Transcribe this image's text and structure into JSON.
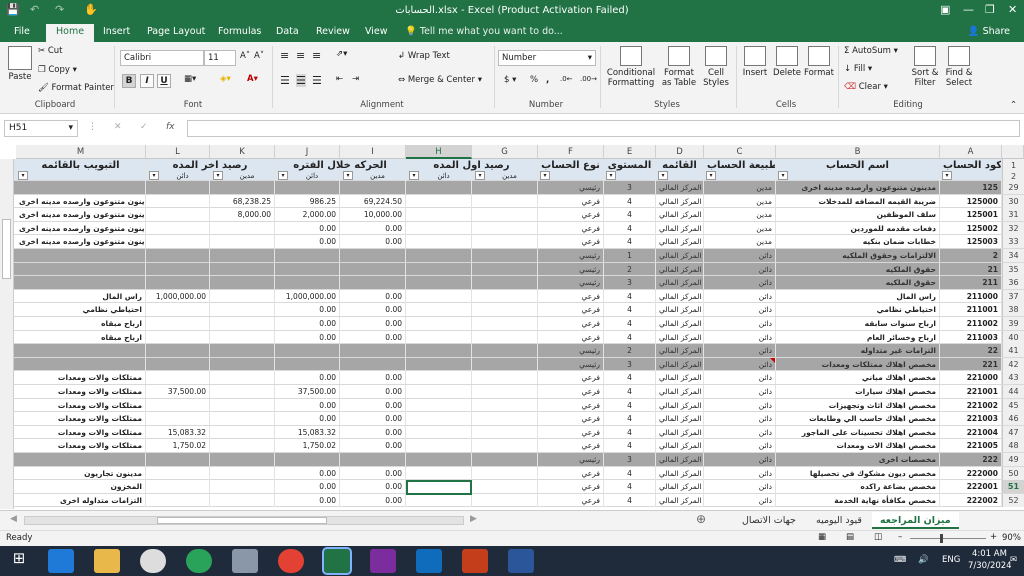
{
  "titlebar": {
    "title": "الحسابات.xlsx - Excel (Product Activation Failed)"
  },
  "menu": {
    "tabs": [
      "File",
      "Home",
      "Insert",
      "Page Layout",
      "Formulas",
      "Data",
      "Review",
      "View"
    ],
    "tell": "Tell me what you want to do...",
    "share": "Share"
  },
  "ribbon": {
    "clipboard": {
      "paste": "Paste",
      "cut": "Cut",
      "copy": "Copy",
      "format_painter": "Format Painter",
      "label": "Clipboard"
    },
    "font": {
      "name": "Calibri",
      "size": "11",
      "bold": "B",
      "italic": "I",
      "underline": "U",
      "label": "Font"
    },
    "alignment": {
      "wrap": "Wrap Text",
      "merge": "Merge & Center",
      "label": "Alignment"
    },
    "number": {
      "format": "Number",
      "currency": "$",
      "percent": "%",
      "comma": ",",
      "label": "Number"
    },
    "styles": {
      "cond": "Conditional Formatting",
      "table": "Format as Table",
      "cell": "Cell Styles",
      "label": "Styles"
    },
    "cells": {
      "insert": "Insert",
      "delete": "Delete",
      "format": "Format",
      "label": "Cells"
    },
    "editing": {
      "autosum": "AutoSum",
      "fill": "Fill",
      "clear": "Clear",
      "sort": "Sort & Filter",
      "find": "Find & Select",
      "label": "Editing"
    }
  },
  "formula": {
    "namebox": "H51",
    "fx": "fx"
  },
  "columns": [
    "M",
    "L",
    "K",
    "J",
    "I",
    "H",
    "G",
    "F",
    "E",
    "D",
    "C",
    "B",
    "A"
  ],
  "header1": {
    "m": "التبويب بالقائمه",
    "lk": "رصيد اخر المده",
    "ji": "الحركه خلال الفتره",
    "hg": "رصيد اول المده",
    "f": "نوع الحساب",
    "e": "المستوى",
    "d": "القائمه",
    "c": "طبيعة الحساب",
    "b": "اسم الحساب",
    "a": "كود الحساب"
  },
  "header2": {
    "l": "دائن",
    "k": "مدين",
    "j": "دائن",
    "i": "مدين",
    "h": "دائن",
    "g": "مدين"
  },
  "rows": [
    {
      "n": "29",
      "grey": true,
      "f": "رئيسي",
      "e": "3",
      "d": "المركز المالي",
      "c": "مدين",
      "b": "مدينون متنوعون وارصده مدينه اخرى",
      "a": "125"
    },
    {
      "n": "30",
      "m": "مدينون متنوعون وارصده مدينه اخرى",
      "k": "68,238.25",
      "j": "986.25",
      "i": "69,224.50",
      "f": "فرعي",
      "e": "4",
      "d": "المركز المالي",
      "c": "مدين",
      "b": "ضريبة القيمه المضافه للمدخلات",
      "a": "125000"
    },
    {
      "n": "31",
      "m": "مدينون متنوعون وارصده مدينه اخرى",
      "k": "8,000.00",
      "j": "2,000.00",
      "i": "10,000.00",
      "f": "فرعي",
      "e": "4",
      "d": "المركز المالي",
      "c": "مدين",
      "b": "سلف الموظفين",
      "a": "125001"
    },
    {
      "n": "32",
      "m": "مدينون متنوعون وارصده مدينه اخرى",
      "j": "0.00",
      "i": "0.00",
      "f": "فرعي",
      "e": "4",
      "d": "المركز المالي",
      "c": "مدين",
      "b": "دفعات مقدمه للموردين",
      "a": "125002"
    },
    {
      "n": "33",
      "m": "مدينون متنوعون وارصده مدينه اخرى",
      "j": "0.00",
      "i": "0.00",
      "f": "فرعي",
      "e": "4",
      "d": "المركز المالي",
      "c": "مدين",
      "b": "خطابات ضمان بنكيه",
      "a": "125003"
    },
    {
      "n": "34",
      "grey": true,
      "f": "رئيسي",
      "e": "1",
      "d": "المركز المالي",
      "c": "دائن",
      "b": "الالتزامات وحقوق الملكيه",
      "a": "2"
    },
    {
      "n": "35",
      "grey": true,
      "f": "رئيسي",
      "e": "2",
      "d": "المركز المالي",
      "c": "دائن",
      "b": "حقوق الملكيه",
      "a": "21"
    },
    {
      "n": "36",
      "grey": true,
      "f": "رئيسي",
      "e": "3",
      "d": "المركز المالي",
      "c": "دائن",
      "b": "حقوق الملكيه",
      "a": "211"
    },
    {
      "n": "37",
      "m": "راس المال",
      "l": "1,000,000.00",
      "j": "1,000,000.00",
      "i": "0.00",
      "f": "فرعي",
      "e": "4",
      "d": "المركز المالي",
      "c": "دائن",
      "b": "راس المال",
      "a": "211000"
    },
    {
      "n": "38",
      "m": "احتياطي نظامي",
      "j": "0.00",
      "i": "0.00",
      "f": "فرعي",
      "e": "4",
      "d": "المركز المالي",
      "c": "دائن",
      "b": "احتياطي نظامي",
      "a": "211001"
    },
    {
      "n": "39",
      "m": "ارباح مبقاه",
      "j": "0.00",
      "i": "0.00",
      "f": "فرعي",
      "e": "4",
      "d": "المركز المالي",
      "c": "دائن",
      "b": "ارباح سنوات سابقه",
      "a": "211002"
    },
    {
      "n": "40",
      "m": "ارباح مبقاه",
      "j": "0.00",
      "i": "0.00",
      "f": "فرعي",
      "e": "4",
      "d": "المركز المالي",
      "c": "دائن",
      "b": "ارباح وخسائر العام",
      "a": "211003"
    },
    {
      "n": "41",
      "grey": true,
      "f": "رئيسي",
      "e": "2",
      "d": "المركز المالي",
      "c": "دائن",
      "b": "التزامات غير متداوله",
      "a": "22"
    },
    {
      "n": "42",
      "grey": true,
      "f": "رئيسي",
      "e": "3",
      "d": "المركز المالي",
      "c": "دائن",
      "b": "مخصص اهلاك ممتلكات ومعدات",
      "a": "221"
    },
    {
      "n": "43",
      "m": "ممتلكات والات ومعدات",
      "j": "0.00",
      "i": "0.00",
      "f": "فرعي",
      "e": "4",
      "d": "المركز المالي",
      "c": "دائن",
      "b": "مخصص اهلاك مباني",
      "a": "221000"
    },
    {
      "n": "44",
      "m": "ممتلكات والات ومعدات",
      "l": "37,500.00",
      "j": "37,500.00",
      "i": "0.00",
      "f": "فرعي",
      "e": "4",
      "d": "المركز المالي",
      "c": "دائن",
      "b": "مخصص اهلاك سيارات",
      "a": "221001"
    },
    {
      "n": "45",
      "m": "ممتلكات والات ومعدات",
      "j": "0.00",
      "i": "0.00",
      "f": "فرعي",
      "e": "4",
      "d": "المركز المالي",
      "c": "دائن",
      "b": "مخصص اهلاك اثاث وتجهيزات",
      "a": "221002"
    },
    {
      "n": "46",
      "m": "ممتلكات والات ومعدات",
      "j": "0.00",
      "i": "0.00",
      "f": "فرعي",
      "e": "4",
      "d": "المركز المالي",
      "c": "دائن",
      "b": "مخصص اهلاك حاسب الي وطابعات",
      "a": "221003"
    },
    {
      "n": "47",
      "m": "ممتلكات والات ومعدات",
      "l": "15,083.32",
      "j": "15,083.32",
      "i": "0.00",
      "f": "فرعي",
      "e": "4",
      "d": "المركز المالي",
      "c": "دائن",
      "b": "مخصص اهلاك تحسينات على الماجور",
      "a": "221004"
    },
    {
      "n": "48",
      "m": "ممتلكات والات ومعدات",
      "l": "1,750.02",
      "j": "1,750.02",
      "i": "0.00",
      "f": "فرعي",
      "e": "4",
      "d": "المركز المالي",
      "c": "دائن",
      "b": "مخصص اهلاك الات ومعدات",
      "a": "221005"
    },
    {
      "n": "49",
      "grey": true,
      "f": "رئيسي",
      "e": "3",
      "d": "المركز المالي",
      "c": "دائن",
      "b": "مخصصات اخرى",
      "a": "222"
    },
    {
      "n": "50",
      "m": "مدينون تجاريون",
      "j": "0.00",
      "i": "0.00",
      "f": "فرعي",
      "e": "4",
      "d": "المركز المالي",
      "c": "دائن",
      "b": "مخصص ديون مشكوك في تحصيلها",
      "a": "222000"
    },
    {
      "n": "51",
      "sel": true,
      "m": "المخزون",
      "j": "0.00",
      "i": "0.00",
      "f": "فرعي",
      "e": "4",
      "d": "المركز المالي",
      "c": "دائن",
      "b": "مخصص بضاعة راكده",
      "a": "222001"
    },
    {
      "n": "52",
      "m": "التزامات متداوله اخرى",
      "j": "0.00",
      "i": "0.00",
      "f": "فرعي",
      "e": "4",
      "d": "المركز المالي",
      "c": "دائن",
      "b": "مخصص مكافأة نهاية الخدمة",
      "a": "222002"
    }
  ],
  "sheets": [
    "جهات الاتصال",
    "قيود اليوميه",
    "ميزان المراجعه"
  ],
  "status": {
    "ready": "Ready",
    "zoom": "90%"
  },
  "taskbar": {
    "lang": "ENG",
    "time": "4:01 AM",
    "date": "7/30/2024"
  }
}
